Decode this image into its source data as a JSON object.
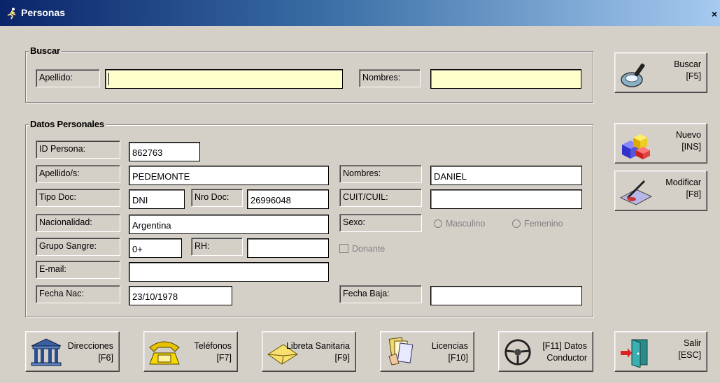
{
  "window": {
    "title": "Personas",
    "close_glyph": "×",
    "icon": "runner-icon"
  },
  "search_group": {
    "legend": "Buscar",
    "apellido_label": "Apellido:",
    "apellido_value": "",
    "nombres_label": "Nombres:",
    "nombres_value": ""
  },
  "personal_group": {
    "legend": "Datos Personales",
    "id_label": "ID Persona:",
    "id_value": "862763",
    "apellidos_label": "Apellido/s:",
    "apellidos_value": "PEDEMONTE",
    "nombres_label": "Nombres:",
    "nombres_value": "DANIEL",
    "tipo_doc_label": "Tipo Doc:",
    "tipo_doc_value": "DNI",
    "nro_doc_label": "Nro Doc:",
    "nro_doc_value": "26996048",
    "cuit_label": "CUIT/CUIL:",
    "cuit_value": "",
    "nacionalidad_label": "Nacionalidad:",
    "nacionalidad_value": "Argentina",
    "sexo_label": "Sexo:",
    "sexo_options": [
      "Masculino",
      "Femenino"
    ],
    "grupo_label": "Grupo Sangre:",
    "grupo_value": "0+",
    "rh_label": "RH:",
    "rh_value": "",
    "donante_label": "Donante",
    "email_label": "E-mail:",
    "email_value": "",
    "fecha_nac_label": "Fecha Nac:",
    "fecha_nac_value": "23/10/1978",
    "fecha_baja_label": "Fecha Baja:",
    "fecha_baja_value": ""
  },
  "side_buttons": {
    "buscar": {
      "line1": "Buscar",
      "line2": "[F5]",
      "icon": "magnifier-icon"
    },
    "nuevo": {
      "line1": "Nuevo",
      "line2": "[INS]",
      "icon": "blocks-icon"
    },
    "modificar": {
      "line1": "Modificar",
      "line2": "[F8]",
      "icon": "edit-pen-icon"
    },
    "salir": {
      "line1": "Salir",
      "line2": "[ESC]",
      "icon": "exit-door-icon"
    }
  },
  "bottom_buttons": {
    "direcciones": {
      "line1": "Direcciones",
      "line2": "[F6]",
      "icon": "building-icon"
    },
    "telefonos": {
      "line1": "Teléfonos",
      "line2": "[F7]",
      "icon": "phone-icon"
    },
    "libreta": {
      "line1": "Libreta Sanitaria",
      "line2": "[F9]",
      "icon": "envelope-icon"
    },
    "licencias": {
      "line1": "Licencias",
      "line2": "[F10]",
      "icon": "documents-icon"
    },
    "conductor": {
      "line1": "[F11] Datos",
      "line2": "Conductor",
      "icon": "steering-wheel-icon"
    }
  }
}
